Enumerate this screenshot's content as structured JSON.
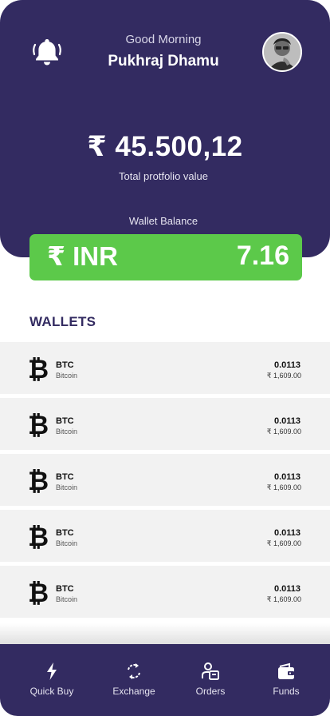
{
  "header": {
    "greeting": "Good Morning",
    "user_name": "Pukhraj Dhamu",
    "total_value": "₹ 45.500,12",
    "total_label": "Total protfolio value",
    "wallet_balance_label": "Wallet Balance",
    "bell_icon": "bell-icon",
    "avatar": "user-avatar"
  },
  "wallet_balance": {
    "currency": "₹ INR",
    "amount": "7.16",
    "color": "#5cc94a"
  },
  "wallets": {
    "title": "WALLETS",
    "items": [
      {
        "symbol": "BTC",
        "name": "Bitcoin",
        "quantity": "0.0113",
        "value": "₹ 1,609.00",
        "icon": "bitcoin-icon"
      },
      {
        "symbol": "BTC",
        "name": "Bitcoin",
        "quantity": "0.0113",
        "value": "₹ 1,609.00",
        "icon": "bitcoin-icon"
      },
      {
        "symbol": "BTC",
        "name": "Bitcoin",
        "quantity": "0.0113",
        "value": "₹ 1,609.00",
        "icon": "bitcoin-icon"
      },
      {
        "symbol": "BTC",
        "name": "Bitcoin",
        "quantity": "0.0113",
        "value": "₹ 1,609.00",
        "icon": "bitcoin-icon"
      },
      {
        "symbol": "BTC",
        "name": "Bitcoin",
        "quantity": "0.0113",
        "value": "₹ 1,609.00",
        "icon": "bitcoin-icon"
      }
    ]
  },
  "nav": {
    "items": [
      {
        "label": "Quick Buy",
        "icon": "lightning-icon"
      },
      {
        "label": "Exchange",
        "icon": "exchange-icon"
      },
      {
        "label": "Orders",
        "icon": "orders-icon"
      },
      {
        "label": "Funds",
        "icon": "wallet-icon"
      }
    ]
  },
  "colors": {
    "primary": "#332b61",
    "accent": "#5cc94a",
    "row_background": "#f2f2f2"
  }
}
